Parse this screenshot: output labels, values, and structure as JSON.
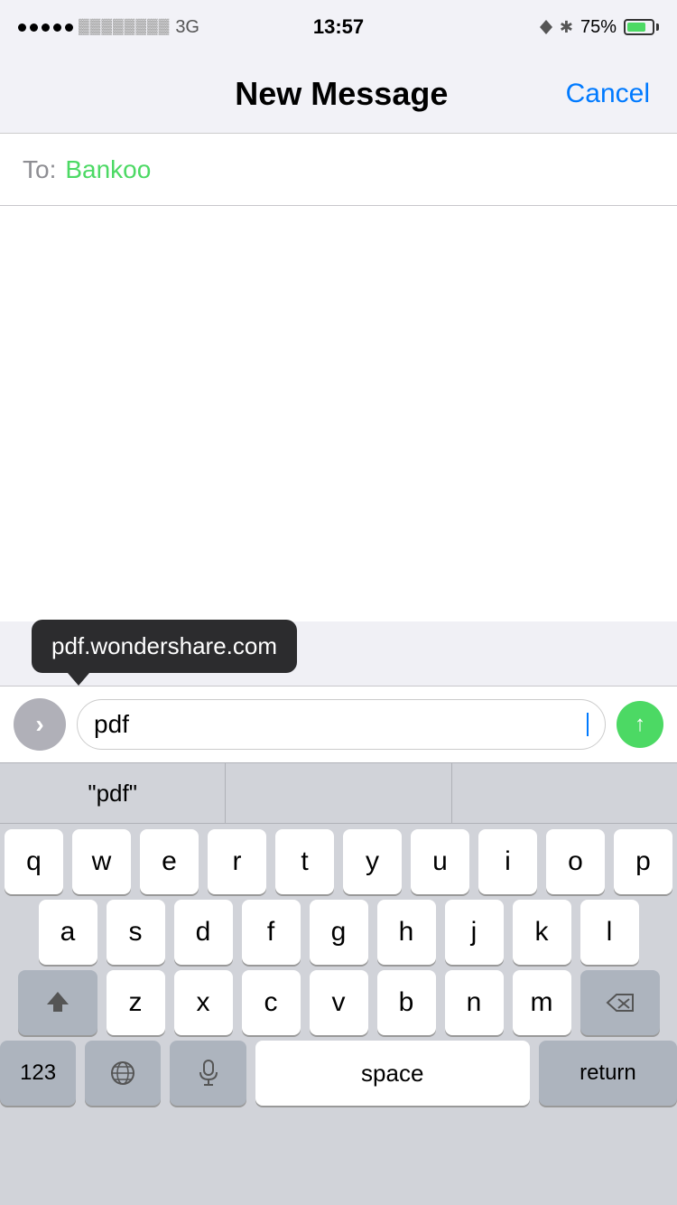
{
  "status_bar": {
    "time": "13:57",
    "carrier": "●●●●●",
    "network": "3G",
    "battery_percent": "75%",
    "icons": {
      "location": "▲",
      "bluetooth": "✱"
    }
  },
  "nav": {
    "title": "New Message",
    "cancel_label": "Cancel"
  },
  "to_field": {
    "label": "To:",
    "recipient": "Bankoo"
  },
  "tooltip": {
    "text": "pdf.wondershare.com"
  },
  "input": {
    "value": "pdf",
    "placeholder": ""
  },
  "autocomplete": {
    "items": [
      "\"pdf\"",
      "",
      ""
    ]
  },
  "keyboard": {
    "rows": [
      [
        "q",
        "w",
        "e",
        "r",
        "t",
        "y",
        "u",
        "i",
        "o",
        "p"
      ],
      [
        "a",
        "s",
        "d",
        "f",
        "g",
        "h",
        "j",
        "k",
        "l"
      ],
      [
        "z",
        "x",
        "c",
        "v",
        "b",
        "n",
        "m"
      ],
      [
        "123",
        "globe",
        "mic",
        "space",
        "return"
      ]
    ],
    "space_label": "space",
    "return_label": "return",
    "num_label": "123"
  }
}
